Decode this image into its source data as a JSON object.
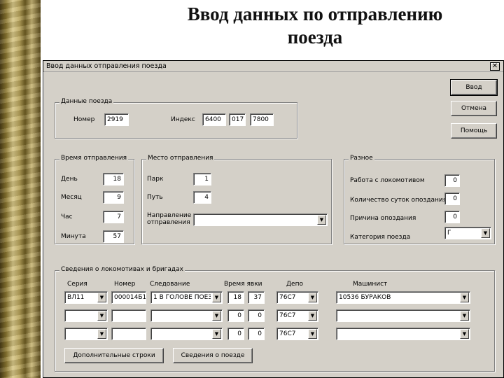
{
  "slide": {
    "title_line1": "Ввод данных по отправлению",
    "title_line2": "поезда"
  },
  "window": {
    "title": "Ввод данных отправления поезда",
    "close_glyph": "✕"
  },
  "buttons": {
    "enter": "Ввод",
    "cancel": "Отмена",
    "help": "Помощь",
    "extra_rows": "Дополнительные строки",
    "train_info": "Сведения о поезде"
  },
  "train_data": {
    "group_label": "Данные поезда",
    "number_label": "Номер",
    "number_value": "2919",
    "index_label": "Индекс",
    "index_part1": "6400",
    "index_part2": "017",
    "index_part3": "7800"
  },
  "departure_time": {
    "group_label": "Время отправления",
    "day_label": "День",
    "day_value": "18",
    "month_label": "Месяц",
    "month_value": "9",
    "hour_label": "Час",
    "hour_value": "7",
    "minute_label": "Минута",
    "minute_value": "57"
  },
  "departure_place": {
    "group_label": "Место отправления",
    "park_label": "Парк",
    "park_value": "1",
    "track_label": "Путь",
    "track_value": "4",
    "direction_label_line1": "Направление",
    "direction_label_line2": "отправления",
    "direction_value": ""
  },
  "misc": {
    "group_label": "Разное",
    "loco_work_label": "Работа с локомотивом",
    "loco_work_value": "0",
    "delay_days_label": "Количество суток опоздания",
    "delay_days_value": "0",
    "delay_reason_label": "Причина опоздания",
    "delay_reason_value": "0",
    "category_label": "Категория поезда",
    "category_value": "Г"
  },
  "crews": {
    "group_label": "Сведения о локомотивах и бригадах",
    "headers": {
      "series": "Серия",
      "number": "Номер",
      "following": "Следование",
      "time": "Время явки",
      "depot": "Депо",
      "driver": "Машинист"
    },
    "rows": [
      {
        "series": "ВЛ11",
        "number": "000014Б1",
        "following": "1 В ГОЛОВЕ ПОЕЗ",
        "hour": "18",
        "min": "37",
        "depot": "76С7",
        "driver": "10536 БУРАКОВ"
      },
      {
        "series": "",
        "number": "",
        "following": "",
        "hour": "0",
        "min": "0",
        "depot": "76С7",
        "driver": ""
      },
      {
        "series": "",
        "number": "",
        "following": "",
        "hour": "0",
        "min": "0",
        "depot": "76С7",
        "driver": ""
      }
    ]
  },
  "icons": {
    "dropdown_arrow": "▼"
  }
}
